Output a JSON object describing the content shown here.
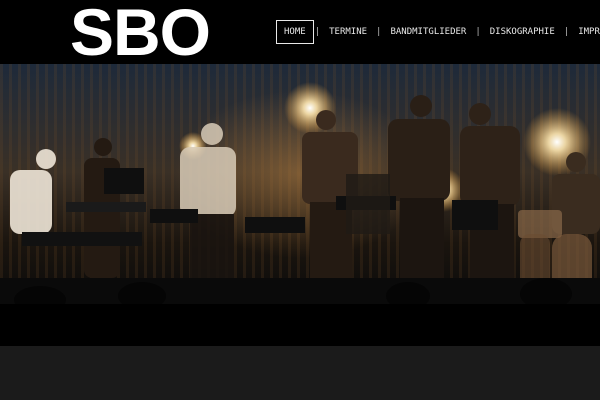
{
  "site": {
    "logo": "SBO"
  },
  "nav": {
    "items": [
      {
        "label": "HOME",
        "active": true
      },
      {
        "label": "TERMINE",
        "active": false
      },
      {
        "label": "BANDMITGLIEDER",
        "active": false
      },
      {
        "label": "DISKOGRAPHIE",
        "active": false
      },
      {
        "label": "IMPRESS",
        "active": false
      }
    ],
    "separator": "|"
  },
  "hero": {
    "image": "band-photo"
  },
  "colors": {
    "header_bg": "#000000",
    "text": "#ffffff",
    "footer_bg": "#1b1b1b"
  }
}
